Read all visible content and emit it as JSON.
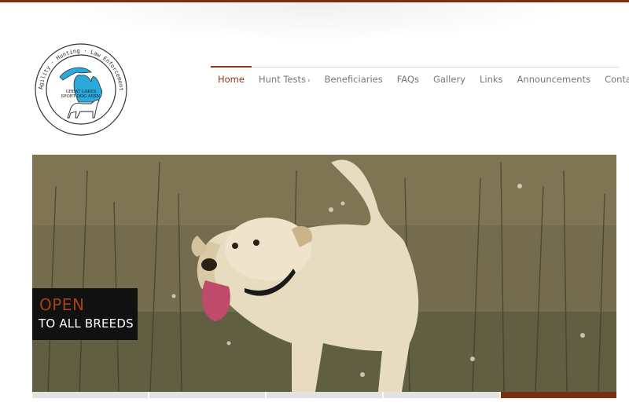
{
  "logo": {
    "ring_text": "Agility · Hunting · Law Enforcement · Obedience",
    "org_line1": "GREAT LAKES",
    "org_line2": "SPORT DOG ASSN.",
    "map_color": "#2aa9dd"
  },
  "nav": {
    "items": [
      {
        "label": "Home",
        "active": true
      },
      {
        "label": "Hunt Tests",
        "has_submenu": true,
        "submenu_icon": "chevron-right-icon"
      },
      {
        "label": "Beneficiaries"
      },
      {
        "label": "FAQs"
      },
      {
        "label": "Gallery"
      },
      {
        "label": "Links"
      },
      {
        "label": "Announcements"
      },
      {
        "label": "Contact"
      }
    ]
  },
  "hero": {
    "image_subject": "yellow labrador retriever running through a field",
    "caption_title": "OPEN",
    "caption_subtitle": "TO ALL BREEDS"
  },
  "slider": {
    "slide_count": 5,
    "active_index": 4
  },
  "colors": {
    "accent": "#7a2f10",
    "caption_title": "#a8401a",
    "nav_text": "#777777",
    "nav_active": "#8a3a14"
  }
}
